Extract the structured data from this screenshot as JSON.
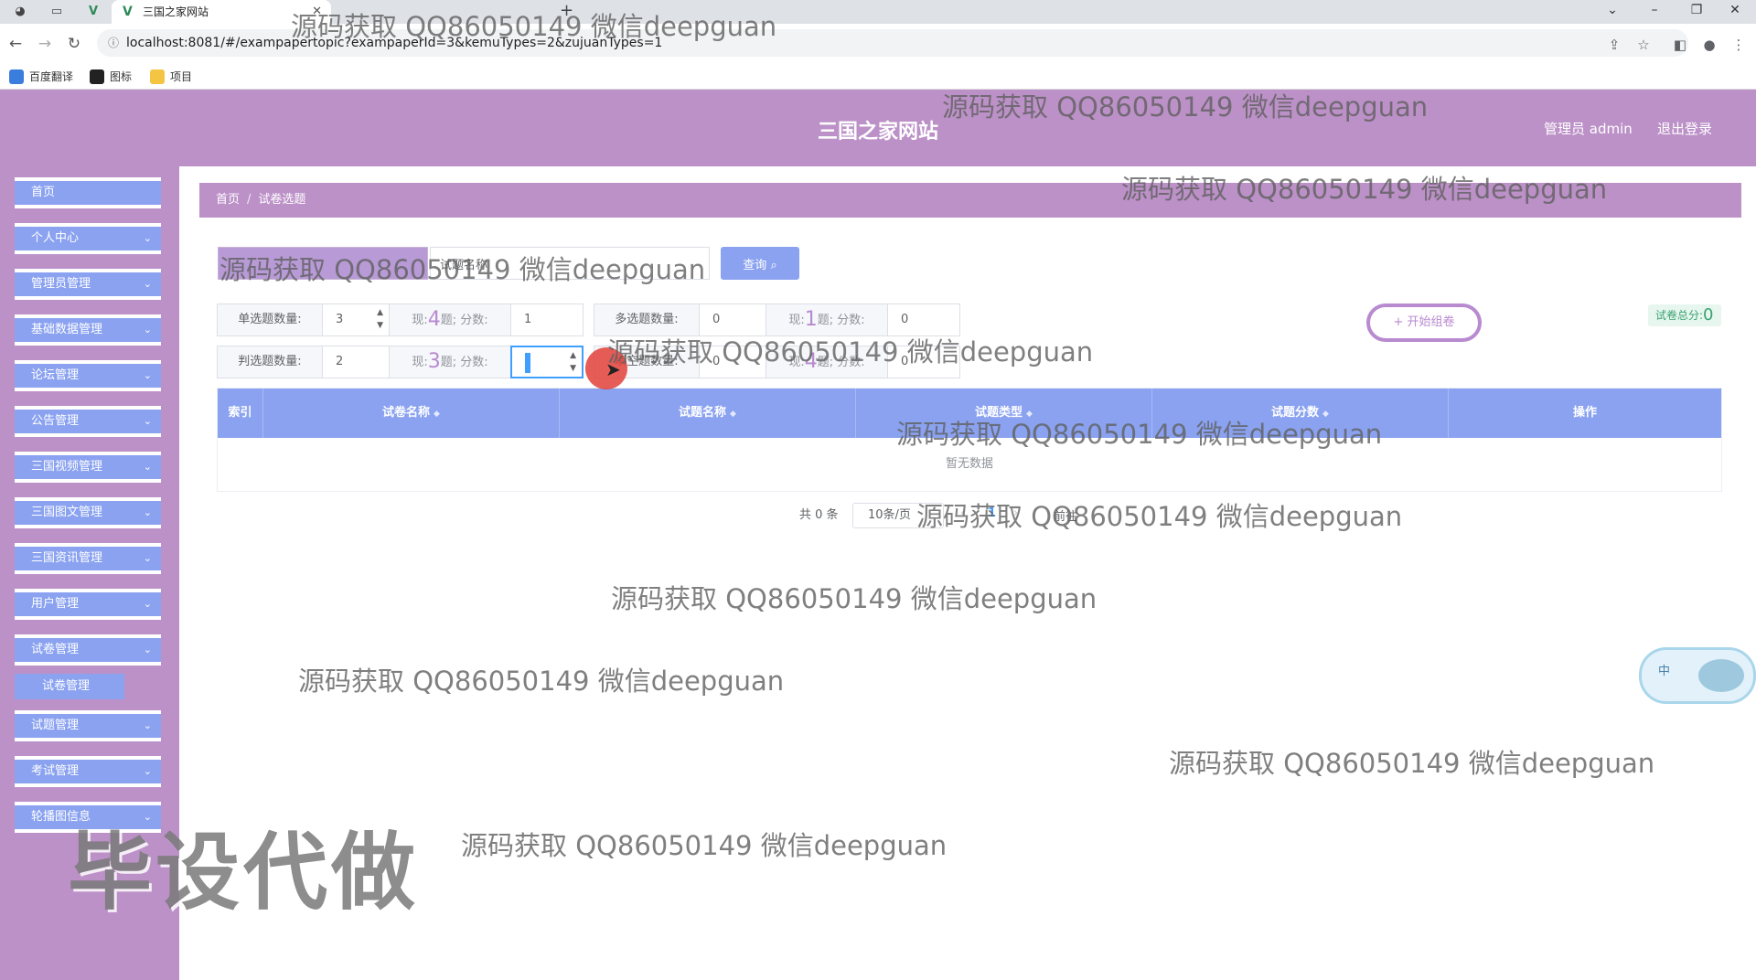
{
  "browser": {
    "active_tab_title": "三国之家网站",
    "second_tab_title": "",
    "url": "localhost:8081/#/exampapertopic?exampaperId=3&kemuTypes=2&zujuanTypes=1",
    "bookmarks": [
      "百度翻译",
      "图标",
      "项目"
    ]
  },
  "header": {
    "site_title": "三国之家网站",
    "admin_label": "管理员 admin",
    "logout_label": "退出登录"
  },
  "sidebar": {
    "items": [
      {
        "label": "首页"
      },
      {
        "label": "个人中心"
      },
      {
        "label": "管理员管理"
      },
      {
        "label": "基础数据管理"
      },
      {
        "label": "论坛管理"
      },
      {
        "label": "公告管理"
      },
      {
        "label": "三国视频管理"
      },
      {
        "label": "三国图文管理"
      },
      {
        "label": "三国资讯管理"
      },
      {
        "label": "用户管理"
      },
      {
        "label": "试卷管理"
      },
      {
        "label": "试题管理"
      },
      {
        "label": "考试管理"
      },
      {
        "label": "轮播图信息"
      }
    ],
    "subitem": "试卷管理"
  },
  "breadcrumb": {
    "home": "首页",
    "current": "试卷选题"
  },
  "search": {
    "input1_value": "",
    "input2_value": "试题名称",
    "query_label": "查询"
  },
  "config": {
    "single": {
      "label": "单选题数量:",
      "count": "3",
      "now_prefix": "现:",
      "now": "4",
      "now_suffix": "题; 分数:",
      "score": "1"
    },
    "multi": {
      "label": "多选题数量:",
      "count": "0",
      "now_prefix": "现:",
      "now": "1",
      "now_suffix": "题; 分数:",
      "score": "0"
    },
    "judge": {
      "label": "判选题数量:",
      "count": "2",
      "now_prefix": "现:",
      "now": "3",
      "now_suffix": "题; 分数:",
      "score": "0"
    },
    "fill": {
      "label": "填空题数量:",
      "count": "0",
      "now_prefix": "现:",
      "now": "4",
      "now_suffix": "题; 分数:",
      "score": "0"
    }
  },
  "actions": {
    "start_label": "开始组卷",
    "total_label": "试卷总分:",
    "total_value": "0"
  },
  "table": {
    "columns": [
      "索引",
      "试卷名称",
      "试题名称",
      "试题类型",
      "试题分数",
      "操作"
    ],
    "empty_text": "暂无数据"
  },
  "pager": {
    "total": "共 0 条",
    "page_size": "10条/页",
    "page": "1",
    "goto": "前往"
  },
  "widget": {
    "label": "中"
  },
  "watermarks": {
    "text": "源码获取 QQ86050149 微信deepguan",
    "big_text": "毕设代做"
  },
  "colors": {
    "header_purple": "#bc91c8",
    "menu_blue": "#8aa2f0",
    "accent_purple": "#b88ad0",
    "score_green": "#3ba272"
  }
}
